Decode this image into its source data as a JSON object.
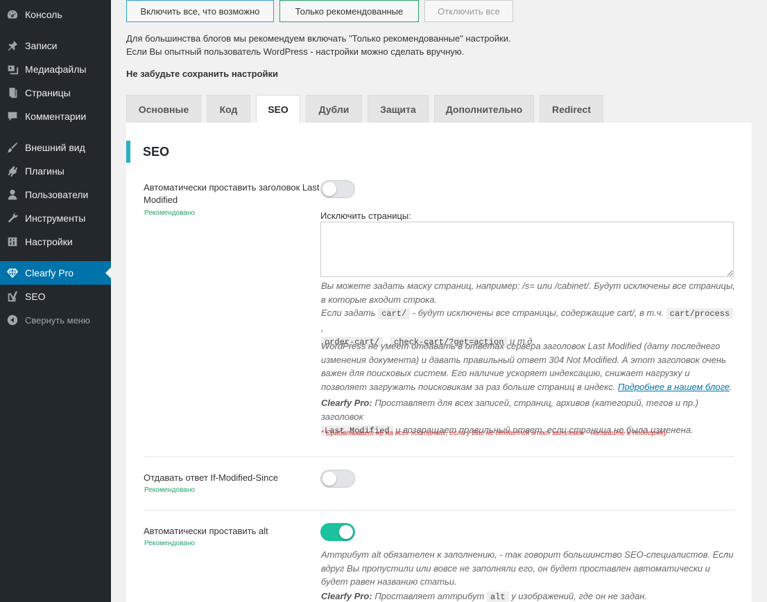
{
  "sidebar": {
    "items": [
      {
        "label": "Консоль",
        "icon": "dashboard-icon"
      },
      {
        "label": "Записи",
        "icon": "pin-icon"
      },
      {
        "label": "Медиафайлы",
        "icon": "media-icon"
      },
      {
        "label": "Страницы",
        "icon": "pages-icon"
      },
      {
        "label": "Комментарии",
        "icon": "comments-icon"
      },
      {
        "label": "Внешний вид",
        "icon": "brush-icon"
      },
      {
        "label": "Плагины",
        "icon": "plugin-icon"
      },
      {
        "label": "Пользователи",
        "icon": "users-icon"
      },
      {
        "label": "Инструменты",
        "icon": "wrench-icon"
      },
      {
        "label": "Настройки",
        "icon": "settings-icon"
      },
      {
        "label": "Clearfy Pro",
        "icon": "diamond-icon"
      },
      {
        "label": "SEO",
        "icon": "yoast-icon"
      },
      {
        "label": "Свернуть меню",
        "icon": "collapse-icon"
      }
    ]
  },
  "top_buttons": {
    "all": "Включить все, что возможно",
    "recommended": "Только рекомендованные",
    "off": "Отключить все"
  },
  "intro": {
    "line1": "Для большинства блогов мы рекомендуем включать \"Только рекомендованные\" настройки.",
    "line2": "Если Вы опытный пользователь WordPress - настройки можно сделать вручную.",
    "save_note": "Не забудьте сохранить настройки"
  },
  "tabs": [
    "Основные",
    "Код",
    "SEO",
    "Дубли",
    "Защита",
    "Дополнительно",
    "Redirect"
  ],
  "panel": {
    "title": "SEO",
    "recommended": "Рекомендовано",
    "opt1": {
      "label": "Автоматически проставить заголовок Last Modified",
      "enabled": false,
      "exclude_label": "Исключить страницы:",
      "exclude_value": "",
      "desc1a": "Вы можете задать маску страниц, например: /s= или /cabinet/. Будут исключены все страницы,",
      "desc1b": "в которые входит строка.",
      "desc2_pre": "Если задать",
      "code_cart": "cart/",
      "desc2_mid": "- будут исключены все страницы, содержащие cart/, в т.ч.",
      "code_cart_process": "cart/process",
      "comma": ",",
      "code_order_cart": "order-cart/",
      "code_check_cart": "check-cart/?get=action",
      "desc2_end": "и т.д.",
      "desc3": "WordPress не умеет отдавать в ответах сервера заголовок Last Modified (дату последнего изменения документа) и давать правильный ответ 304 Not Modified. А этот заголовок очень важен для поисковых систем. Его наличие ускоряет индексацию, снижает нагрузку и позволяет загружать поисковикам за раз больше страниц в индекс.",
      "link": "Подробнее в нашем блоге",
      "period": ".",
      "clearfy_pro": "Clearfy Pro:",
      "desc4a": "Проставляет для всех записей, страниц, архивов (категорий, тегов и пр.) заголовок",
      "code_last_modified": "Last Modified",
      "desc4b": "и возвращает правильный ответ, если страница не была изменена.",
      "warning": "* Срабатывает не на всех хостингах, если у Вас не отдается этот заголовок - напишите в поддержку"
    },
    "opt2": {
      "label": "Отдавать ответ If-Modified-Since",
      "enabled": false
    },
    "opt3": {
      "label": "Автоматически проставить alt",
      "enabled": true,
      "desc1": "Аттрибут alt обязателен к заполнению, - так говорит большинство SEO-специалистов. Если вдруг Вы пропустили или вовсе не заполняли его, он будет проставлен автоматически и будет равен названию статьи.",
      "clearfy_pro": "Clearfy Pro:",
      "desc2a": "Проставляет аттрибут",
      "code_alt": "alt",
      "desc2b": "у изображений, где он не задан."
    }
  }
}
